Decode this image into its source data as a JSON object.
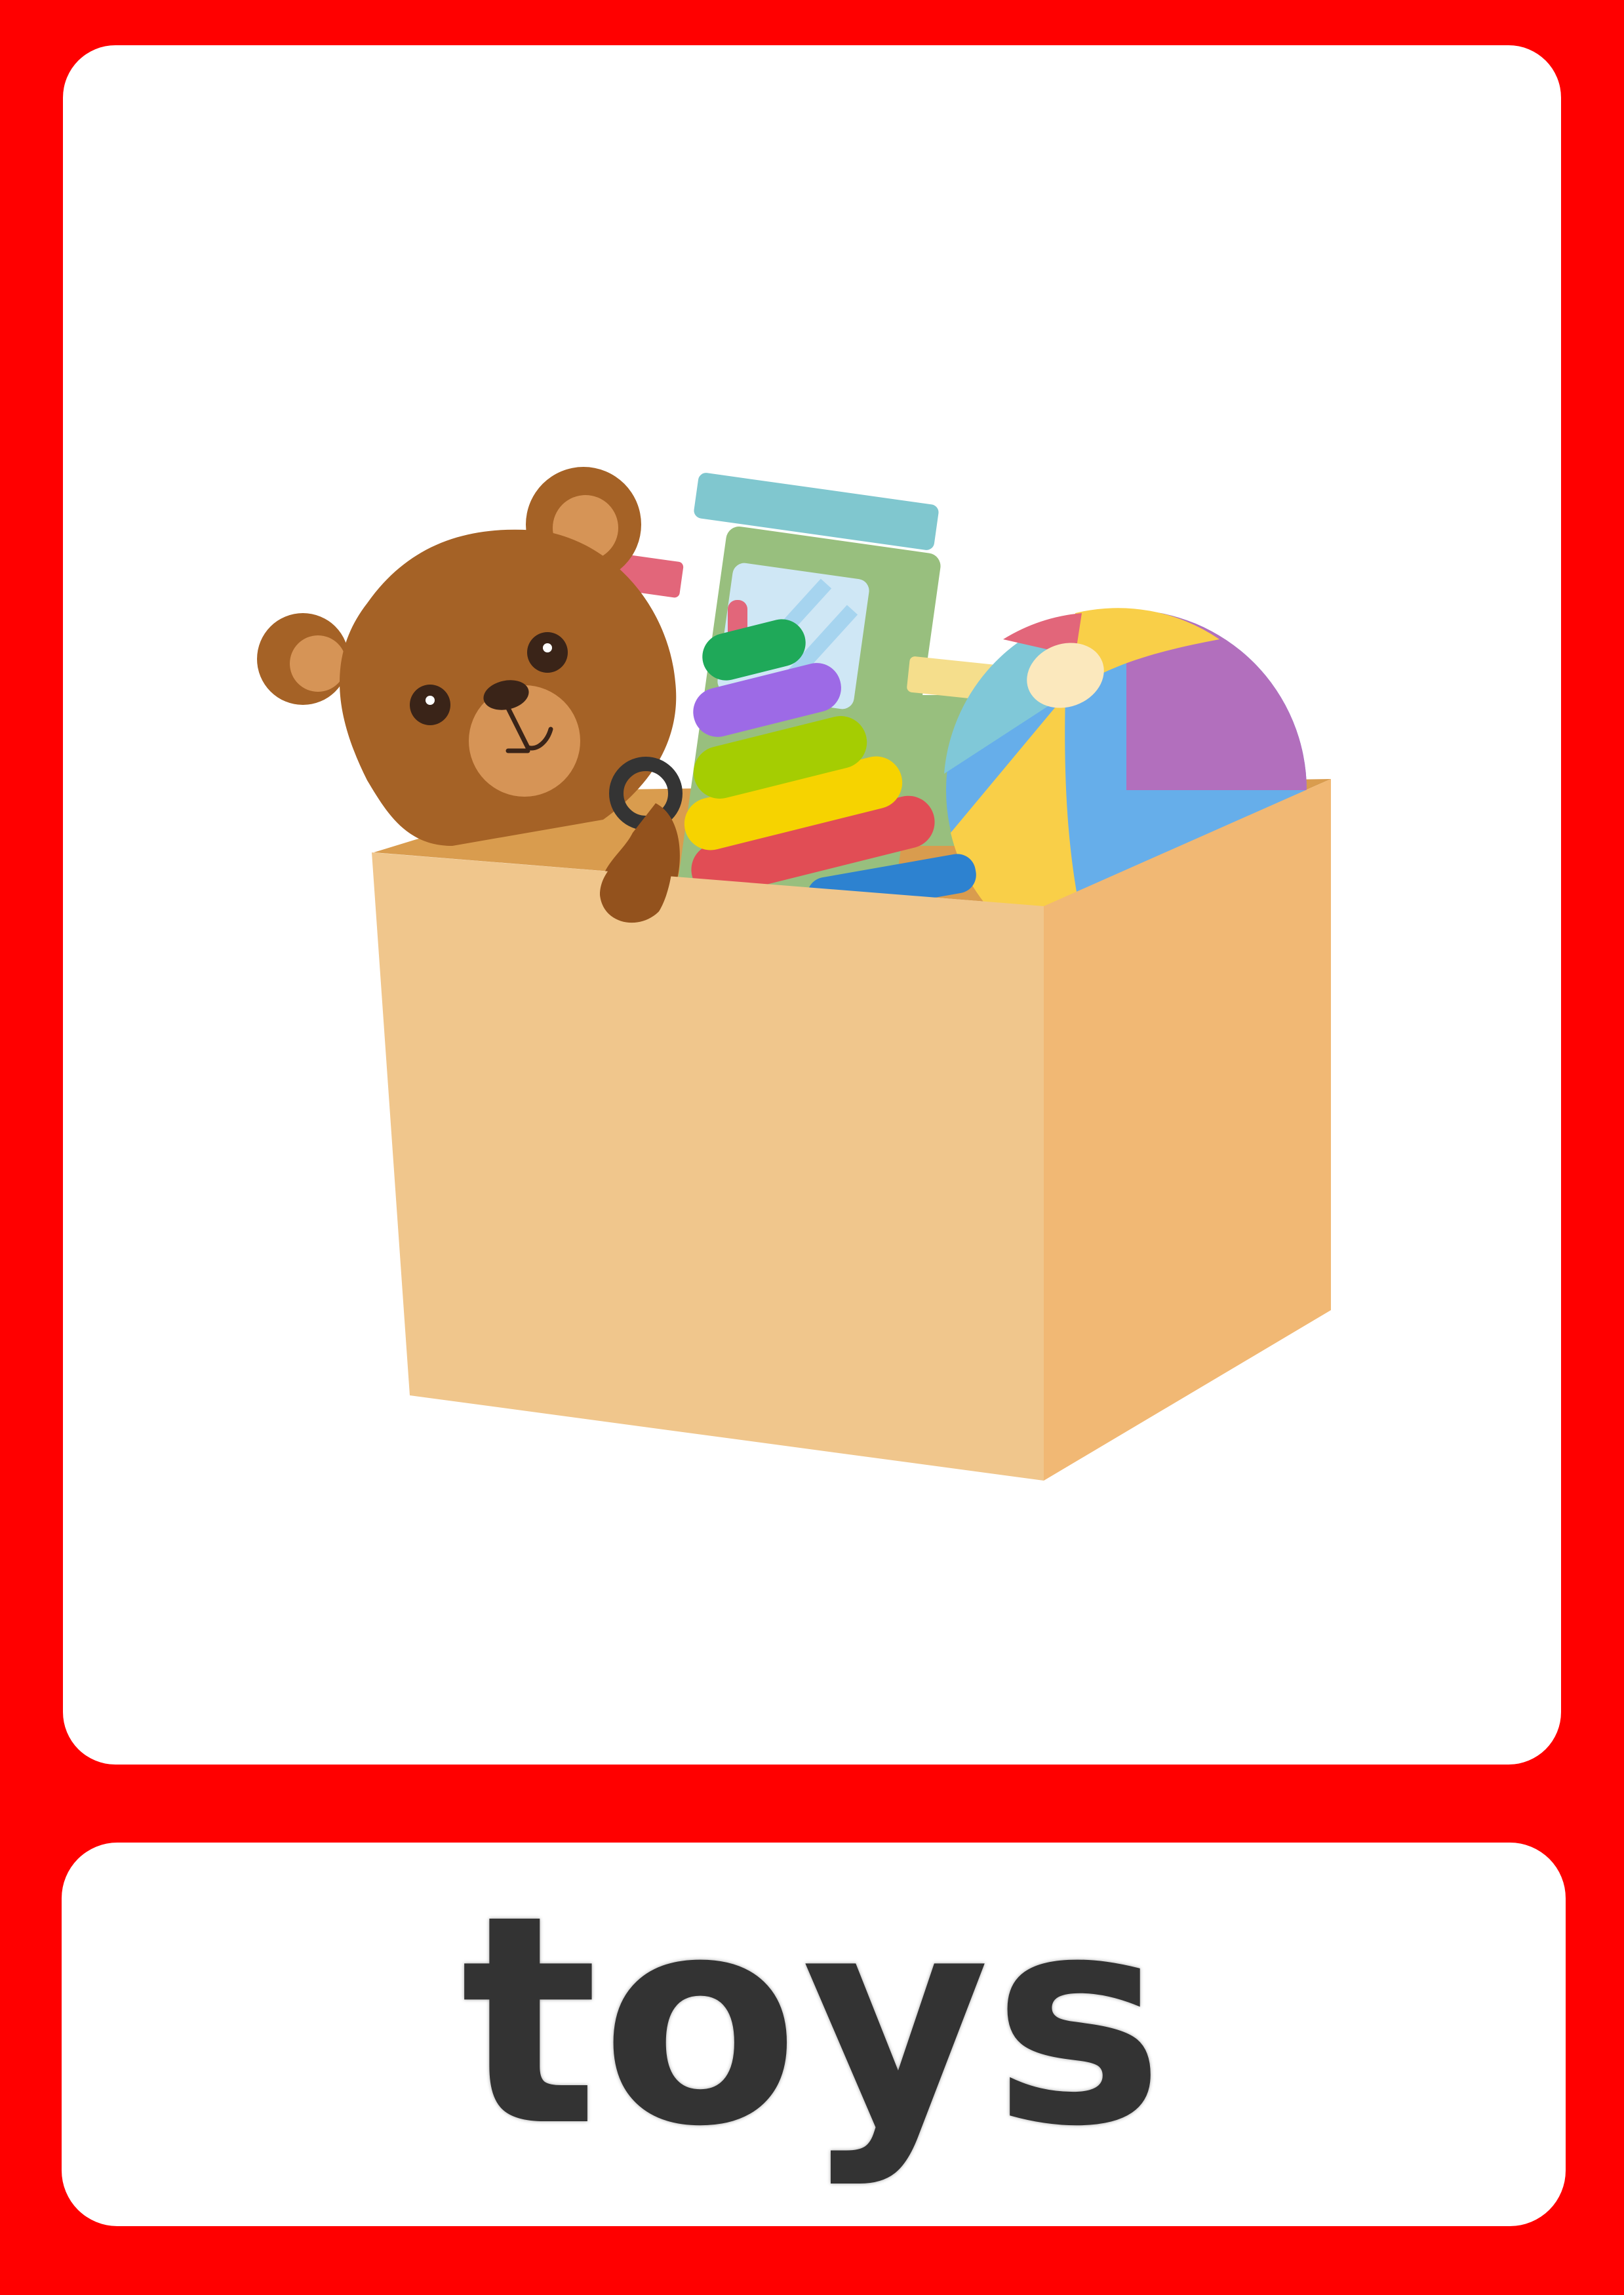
{
  "card": {
    "word": "toys",
    "illustration_icon": "toy-box-icon"
  },
  "colors": {
    "frame": "#ff0000",
    "panel": "#ffffff",
    "text": "#333333",
    "box_front": "#f0c68c",
    "box_side": "#f1b874",
    "bear": "#a56226",
    "bear_muzzle": "#d69456"
  }
}
